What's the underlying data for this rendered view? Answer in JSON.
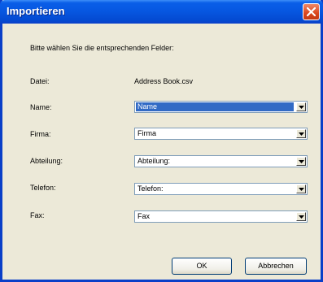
{
  "window": {
    "title": "Importieren"
  },
  "dialog": {
    "instruction": "Bitte wählen Sie die entsprechenden Felder:",
    "file_label": "Datei:",
    "file_value": "Address Book.csv",
    "fields": [
      {
        "label": "Name:",
        "value": "Name",
        "selected": true
      },
      {
        "label": "Firma:",
        "value": "Firma"
      },
      {
        "label": "Abteilung:",
        "value": "Abteilung:"
      },
      {
        "label": "Telefon:",
        "value": "Telefon:"
      },
      {
        "label": "Fax:",
        "value": "Fax"
      }
    ]
  },
  "buttons": {
    "ok": "OK",
    "cancel": "Abbrechen"
  },
  "colors": {
    "title_bar": "#0656e0",
    "selection": "#316ac5",
    "close_button": "#d9461e"
  }
}
